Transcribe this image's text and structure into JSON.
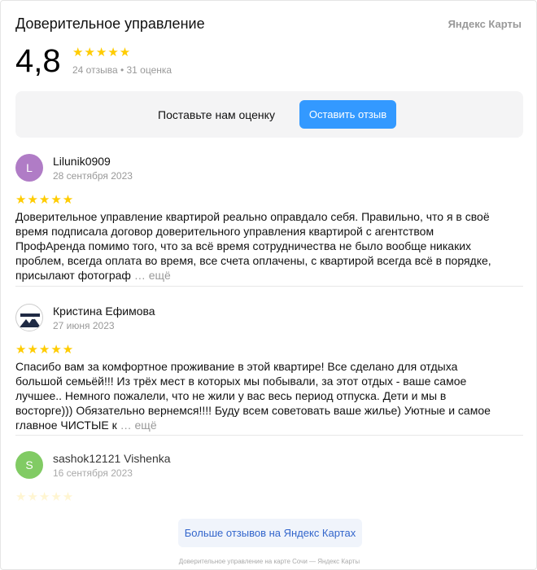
{
  "header": {
    "title": "Доверительное управление",
    "brand": "Яндекс Карты"
  },
  "summary": {
    "rating": "4,8",
    "stars": "★★★★★",
    "counts": "24 отзыва • 31 оценка"
  },
  "promo": {
    "text": "Поставьте нам оценку",
    "button": "Оставить отзыв"
  },
  "reviews": [
    {
      "initial": "L",
      "author": "Lilunik0909",
      "date": "28 сентября 2023",
      "stars": "★★★★★",
      "text": "Доверительное управление квартирой реально оправдало себя. Правильно, что я в своё время подписала договор доверительного управления квартирой с агентством ПрофАренда помимо того, что за всё время сотрудничества не было вообще никаких проблем, всегда оплата во время, все счета оплачены, с квартирой всегда всё в порядке, присылают фотограф",
      "more": "… ещё"
    },
    {
      "initial": "",
      "author": "Кристина Ефимова",
      "date": "27 июня 2023",
      "stars": "★★★★★",
      "text": "Спасибо вам за комфортное проживание в этой квартире! Все сделано для отдыха большой семьёй!!! Из трёх мест в которых мы побывали, за этот отдых - ваше самое лучшее.. Немного пожалели, что не жили у вас весь период отпуска. Дети и мы в восторге))) Обязательно вернемся!!!! Буду всем советовать ваше жилье) Уютные и самое главное ЧИСТЫЕ к",
      "more": "… ещё"
    },
    {
      "initial": "S",
      "author": "sashok12121 Vishenka",
      "date": "16 сентября 2023",
      "stars": "★★★★★"
    }
  ],
  "more_button": "Больше отзывов на Яндекс Картах",
  "footer": "Доверительное управление на карте Сочи — Яндекс Карты",
  "colors": {
    "accent": "#3399ff",
    "star": "#ffcc00",
    "avatar_1": "#b07cc6",
    "avatar_3": "#6cc24a"
  }
}
